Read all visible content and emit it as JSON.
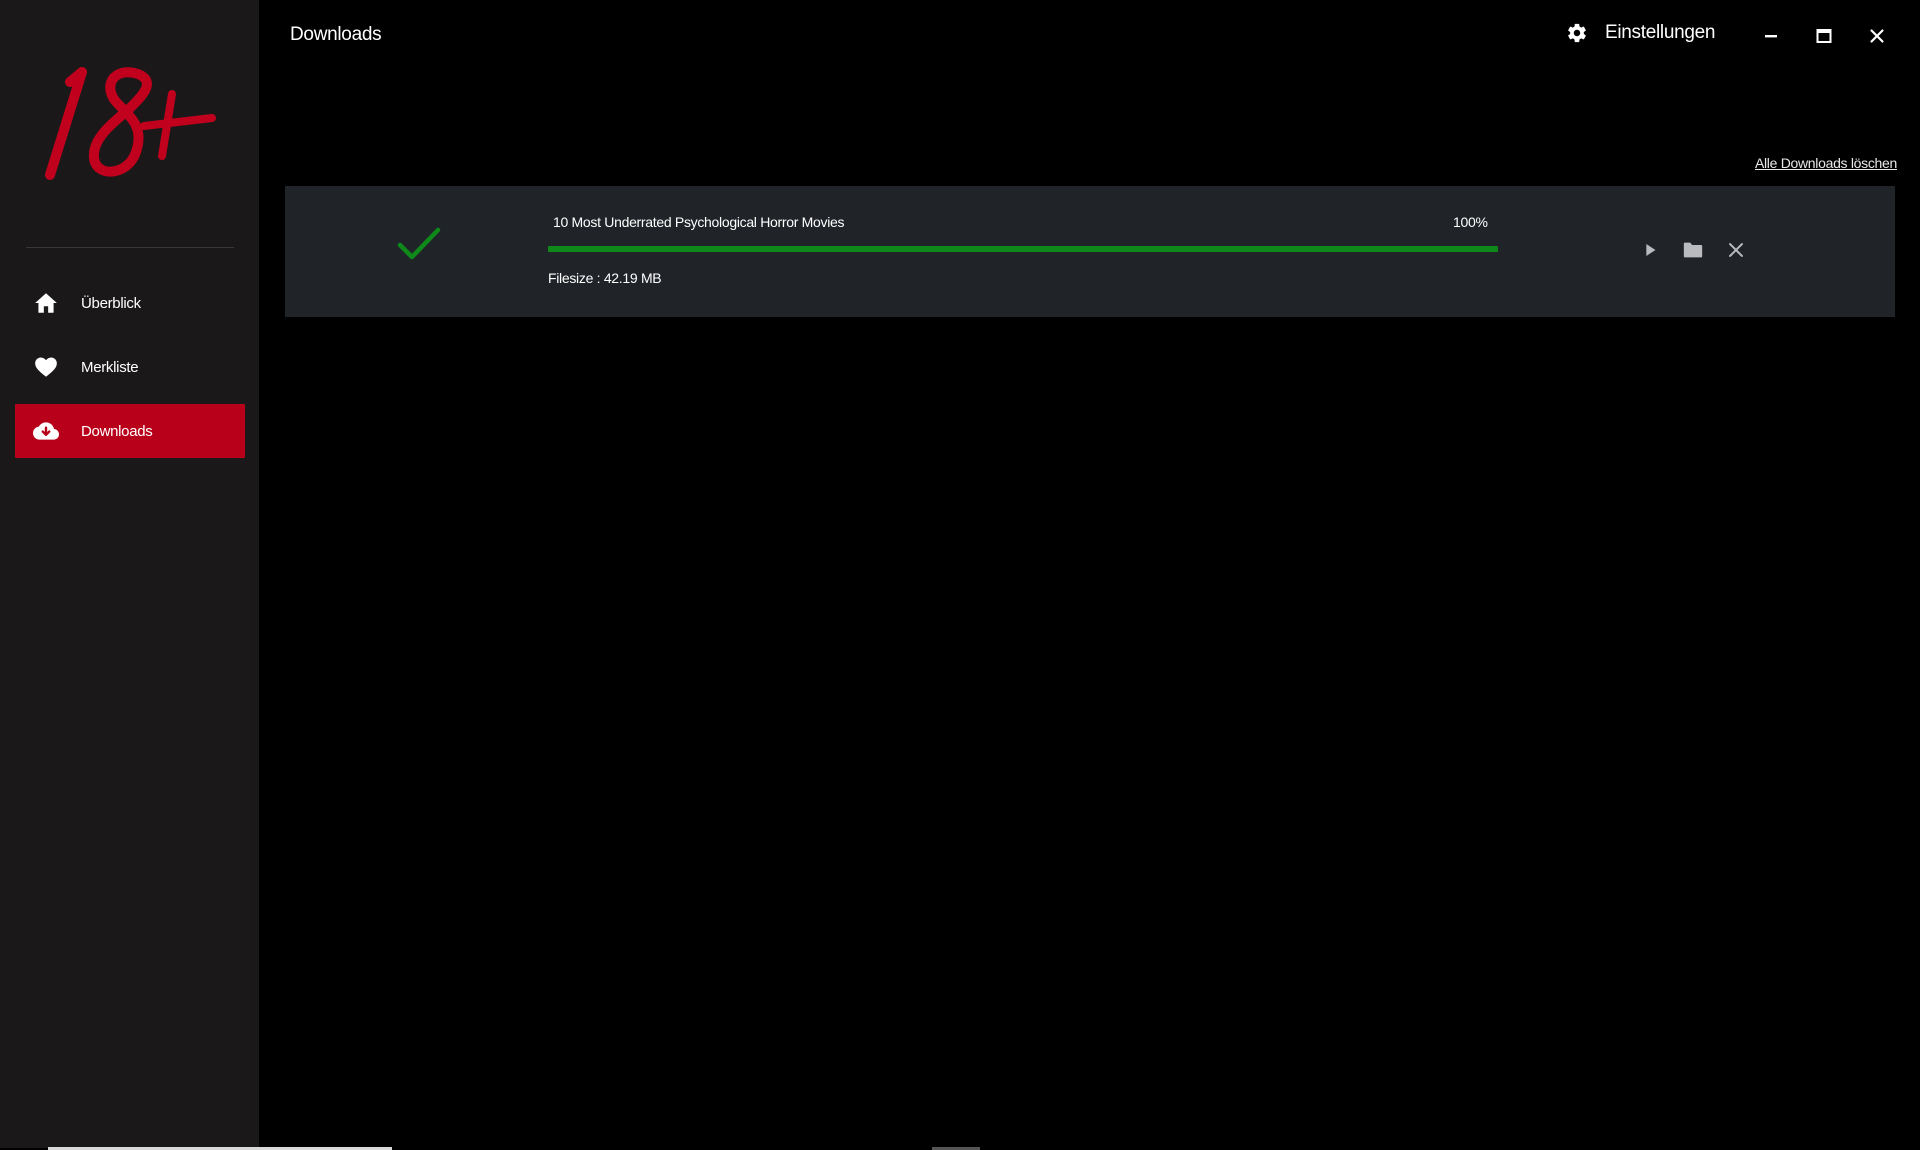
{
  "app": {
    "logo_text": "18+",
    "brand_color": "#c0001c",
    "accent_active": "#b8001a"
  },
  "sidebar": {
    "items": [
      {
        "label": "Überblick",
        "icon": "home-icon",
        "active": false
      },
      {
        "label": "Merkliste",
        "icon": "heart-icon",
        "active": false
      },
      {
        "label": "Downloads",
        "icon": "cloud-download-icon",
        "active": true
      }
    ]
  },
  "header": {
    "title": "Downloads",
    "settings_label": "Einstellungen",
    "settings_icon": "gear-icon",
    "window_controls": [
      "minimize-icon",
      "maximize-icon",
      "close-icon"
    ]
  },
  "main": {
    "clear_all_label": "Alle Downloads löschen",
    "downloads": [
      {
        "title": "10 Most Underrated Psychological Horror Movies",
        "percent_label": "100%",
        "progress": 1.0,
        "filesize_label": "Filesize : 42.19 MB",
        "status_icon": "checkmark-icon",
        "status_color": "#0f8a1a",
        "actions": [
          "play-icon",
          "folder-icon",
          "close-icon"
        ]
      }
    ]
  }
}
